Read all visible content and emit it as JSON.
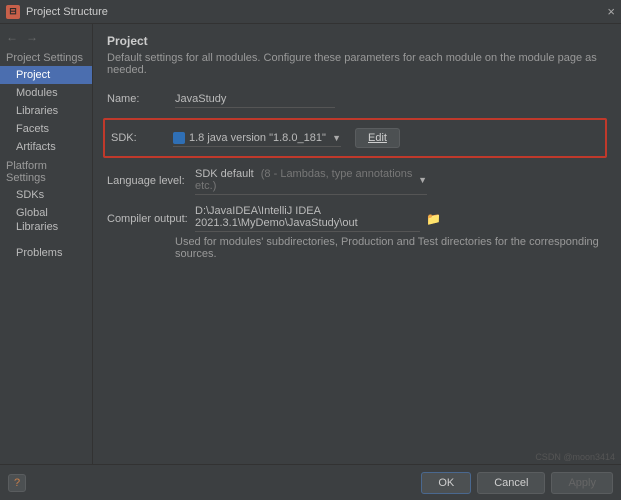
{
  "window": {
    "title": "Project Structure",
    "close": "×"
  },
  "sidebar": {
    "nav": {
      "back": "←",
      "forward": "→"
    },
    "sections": [
      {
        "header": "Project Settings",
        "items": [
          {
            "label": "Project",
            "selected": true
          },
          {
            "label": "Modules"
          },
          {
            "label": "Libraries"
          },
          {
            "label": "Facets"
          },
          {
            "label": "Artifacts"
          }
        ]
      },
      {
        "header": "Platform Settings",
        "items": [
          {
            "label": "SDKs"
          },
          {
            "label": "Global Libraries"
          }
        ]
      },
      {
        "header": "",
        "items": [
          {
            "label": "Problems"
          }
        ]
      }
    ]
  },
  "main": {
    "heading": "Project",
    "subtitle": "Default settings for all modules. Configure these parameters for each module on the module page as needed.",
    "name_label": "Name:",
    "name_value": "JavaStudy",
    "sdk_label": "SDK:",
    "sdk_value": "1.8 java version \"1.8.0_181\"",
    "edit_label": "Edit",
    "lang_label": "Language level:",
    "lang_value": "SDK default",
    "lang_hint": "(8 - Lambdas, type annotations etc.)",
    "output_label": "Compiler output:",
    "output_value": "D:\\JavaIDEA\\IntelliJ IDEA 2021.3.1\\MyDemo\\JavaStudy\\out",
    "output_hint": "Used for modules' subdirectories, Production and Test directories for the corresponding sources."
  },
  "footer": {
    "ok": "OK",
    "cancel": "Cancel",
    "apply": "Apply"
  },
  "watermark": "CSDN @moon3414"
}
